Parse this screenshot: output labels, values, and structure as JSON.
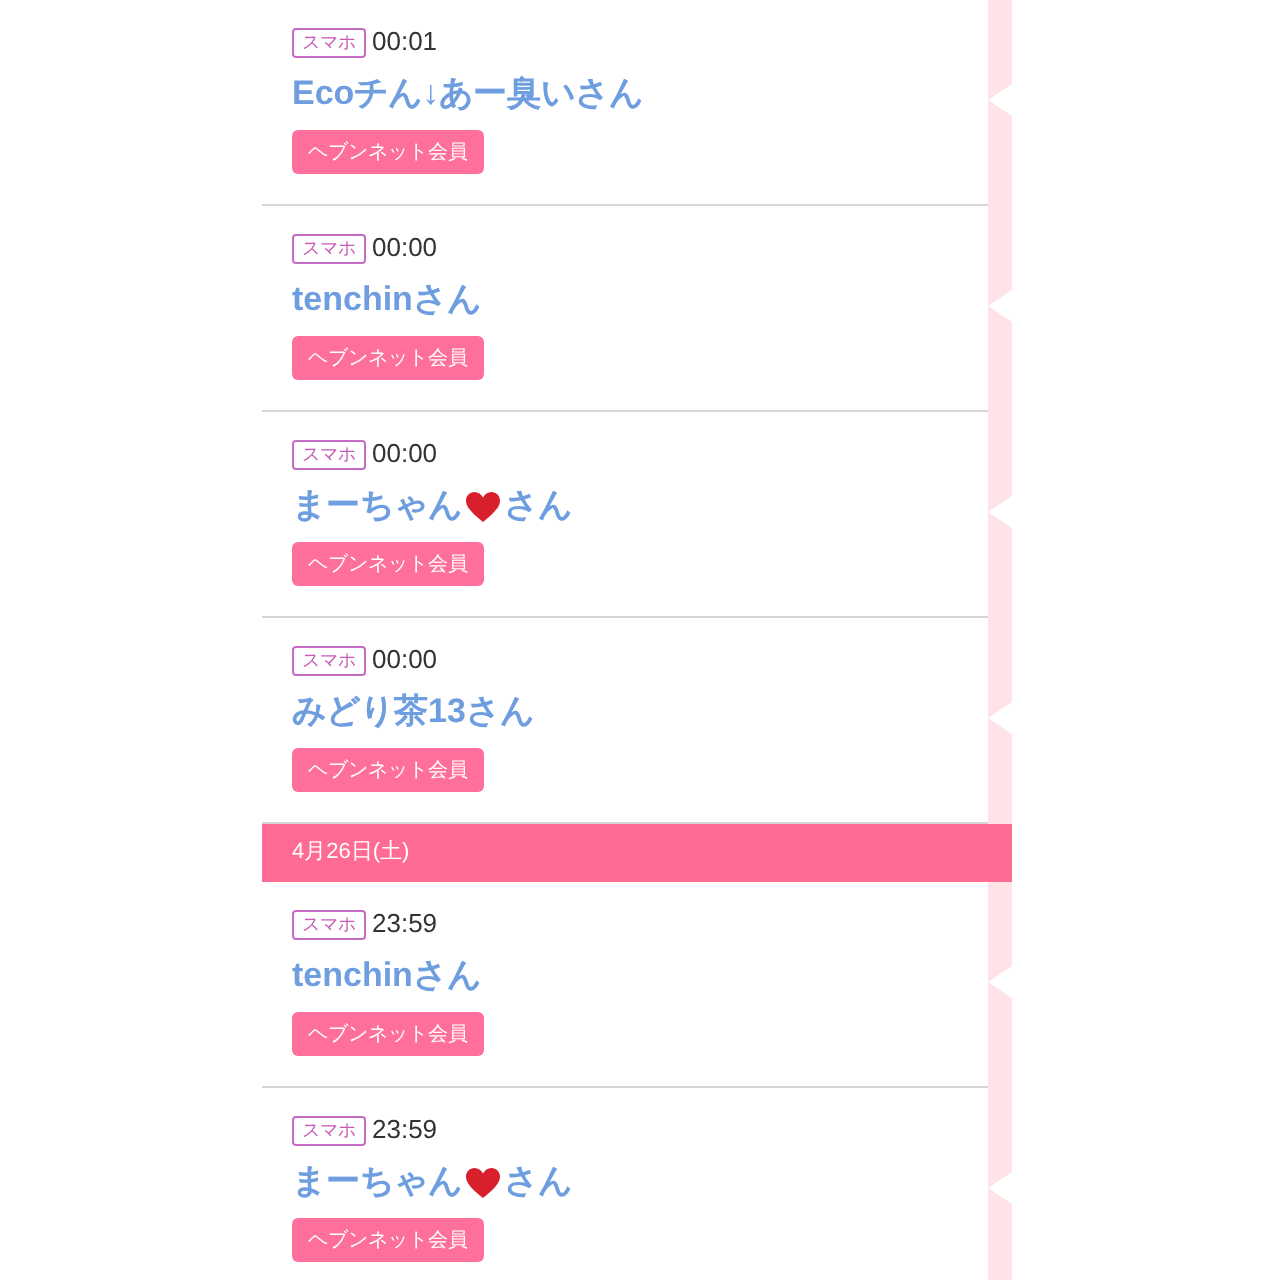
{
  "groups": [
    {
      "entries": [
        {
          "tag": "スマホ",
          "time": "00:01",
          "name": [
            {
              "kind": "text",
              "text": "Ecoチん↓あー臭いさん"
            }
          ],
          "badge": "ヘブンネット会員"
        },
        {
          "tag": "スマホ",
          "time": "00:00",
          "name": [
            {
              "kind": "text",
              "text": "tenchinさん"
            }
          ],
          "badge": "ヘブンネット会員"
        },
        {
          "tag": "スマホ",
          "time": "00:00",
          "name": [
            {
              "kind": "text",
              "text": "まーちゃん"
            },
            {
              "kind": "heart"
            },
            {
              "kind": "text",
              "text": "さん"
            }
          ],
          "badge": "ヘブンネット会員"
        },
        {
          "tag": "スマホ",
          "time": "00:00",
          "name": [
            {
              "kind": "text",
              "text": "みどり茶13さん"
            }
          ],
          "badge": "ヘブンネット会員"
        }
      ]
    },
    {
      "date": "4月26日(土)",
      "entries": [
        {
          "tag": "スマホ",
          "time": "23:59",
          "name": [
            {
              "kind": "text",
              "text": "tenchinさん"
            }
          ],
          "badge": "ヘブンネット会員"
        },
        {
          "tag": "スマホ",
          "time": "23:59",
          "name": [
            {
              "kind": "text",
              "text": "まーちゃん"
            },
            {
              "kind": "heart"
            },
            {
              "kind": "text",
              "text": "さん"
            }
          ],
          "badge": "ヘブンネット会員"
        }
      ]
    }
  ]
}
